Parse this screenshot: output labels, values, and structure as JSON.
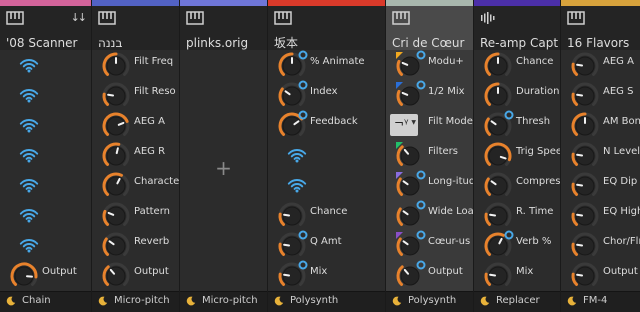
{
  "colors": {
    "active": "#e8822c",
    "inactive": "#3a3a3a",
    "knob_body": "#242424",
    "accent_blue": "#48a8e8",
    "wifi": "#48a8e8",
    "moon": "#e8b23a"
  },
  "columns": [
    {
      "title": "'08 Scanner",
      "device_icon": "piano-keys-icon",
      "corner": "↓↓",
      "color": "#d2639a",
      "footer": "Chain",
      "params": [
        {
          "type": "wifi"
        },
        {
          "type": "wifi"
        },
        {
          "type": "wifi"
        },
        {
          "type": "wifi"
        },
        {
          "type": "wifi"
        },
        {
          "type": "wifi"
        },
        {
          "type": "wifi"
        },
        {
          "type": "knob",
          "label": "Output",
          "value": 0.85
        }
      ]
    },
    {
      "title": "בננה",
      "device_icon": "piano-keys-icon",
      "color": "#5262c4",
      "footer": "Micro-pitch",
      "params": [
        {
          "type": "knob",
          "label": "Filt Freq",
          "value": 0.5
        },
        {
          "type": "knob",
          "label": "Filt Reso",
          "value": 0.2
        },
        {
          "type": "knob",
          "label": "AEG A",
          "value": 0.75
        },
        {
          "type": "knob",
          "label": "AEG R",
          "value": 0.55
        },
        {
          "type": "knob",
          "label": "Character",
          "value": 0.6
        },
        {
          "type": "knob",
          "label": "Pattern",
          "value": 0.25
        },
        {
          "type": "knob",
          "label": "Reverb",
          "value": 0.3
        },
        {
          "type": "knob",
          "label": "Output",
          "value": 0.35
        }
      ]
    },
    {
      "title": "plinks.orig",
      "device_icon": "piano-keys-icon",
      "color": "#6f76d8",
      "footer": "Micro-pitch",
      "params": []
    },
    {
      "title": "坂本",
      "device_icon": "piano-keys-icon",
      "color": "#d93a2a",
      "footer": "Polysynth",
      "params": [
        {
          "type": "knob",
          "label": "% Animate",
          "value": 0.5,
          "mod": true
        },
        {
          "type": "knob",
          "label": "Index",
          "value": 0.3,
          "mod": true
        },
        {
          "type": "knob",
          "label": "Feedback",
          "value": 0.7,
          "mod": true
        },
        {
          "type": "wifi"
        },
        {
          "type": "wifi"
        },
        {
          "type": "knob",
          "label": "Chance",
          "value": 0.2
        },
        {
          "type": "knob",
          "label": "Q Amt",
          "value": 0.2,
          "mod": true
        },
        {
          "type": "knob",
          "label": "Mix",
          "value": 0.2,
          "mod": true
        }
      ]
    },
    {
      "title": "Cri de Cœur",
      "device_icon": "piano-keys-icon",
      "color": "#a8b7ad",
      "footer": "Polysynth",
      "selected": true,
      "params": [
        {
          "type": "knob",
          "label": "Modu+",
          "value": 0.25,
          "mod": true,
          "tag": "#f0a820"
        },
        {
          "type": "knob",
          "label": "1/2 Mix",
          "value": 0.25,
          "mod": true,
          "tag": "#2a6fd8"
        },
        {
          "type": "select",
          "label": "Filt Mode",
          "value": "¬ᵞ"
        },
        {
          "type": "knob",
          "label": "Filters",
          "value": 0.35,
          "tag": "#22c06a"
        },
        {
          "type": "knob",
          "label": "Long-itude",
          "value": 0.3,
          "mod": true,
          "tag": "#8a6de0"
        },
        {
          "type": "knob",
          "label": "Wide Load",
          "value": 0.3,
          "mod": true
        },
        {
          "type": "knob",
          "label": "Cœur-us",
          "value": 0.3,
          "mod": true,
          "tag": "#8a4fc8"
        },
        {
          "type": "knob",
          "label": "Output",
          "value": 0.35,
          "mod": true
        }
      ]
    },
    {
      "title": "Re-amp Capture",
      "device_icon": "waveform-icon",
      "color": "#4b2fa8",
      "footer": "Replacer",
      "params": [
        {
          "type": "knob",
          "label": "Chance",
          "value": 0.5
        },
        {
          "type": "knob",
          "label": "Duration",
          "value": 0.5
        },
        {
          "type": "knob",
          "label": "Thresh",
          "value": 0.3,
          "mod": true
        },
        {
          "type": "knob",
          "label": "Trig Speed",
          "value": 0.9
        },
        {
          "type": "knob",
          "label": "Compress",
          "value": 0.3
        },
        {
          "type": "knob",
          "label": "R. Time",
          "value": 0.2
        },
        {
          "type": "knob",
          "label": "Verb %",
          "value": 0.6,
          "mod": true
        },
        {
          "type": "knob",
          "label": "Mix",
          "value": 0.2
        }
      ]
    },
    {
      "title": "16 Flavors",
      "device_icon": "piano-keys-icon",
      "color": "#d7a23c",
      "footer": "FM-4",
      "params": [
        {
          "type": "knob",
          "label": "AEG A",
          "value": 0.2
        },
        {
          "type": "knob",
          "label": "AEG S",
          "value": 0.2
        },
        {
          "type": "knob",
          "label": "AM Bonus",
          "value": 0.5
        },
        {
          "type": "knob",
          "label": "N Level",
          "value": 0.2
        },
        {
          "type": "knob",
          "label": "EQ Dip",
          "value": 0.2
        },
        {
          "type": "knob",
          "label": "EQ Highs",
          "value": 0.2
        },
        {
          "type": "knob",
          "label": "Chor/Flng",
          "value": 0.2
        },
        {
          "type": "knob",
          "label": "Output",
          "value": 0.2
        }
      ]
    }
  ]
}
